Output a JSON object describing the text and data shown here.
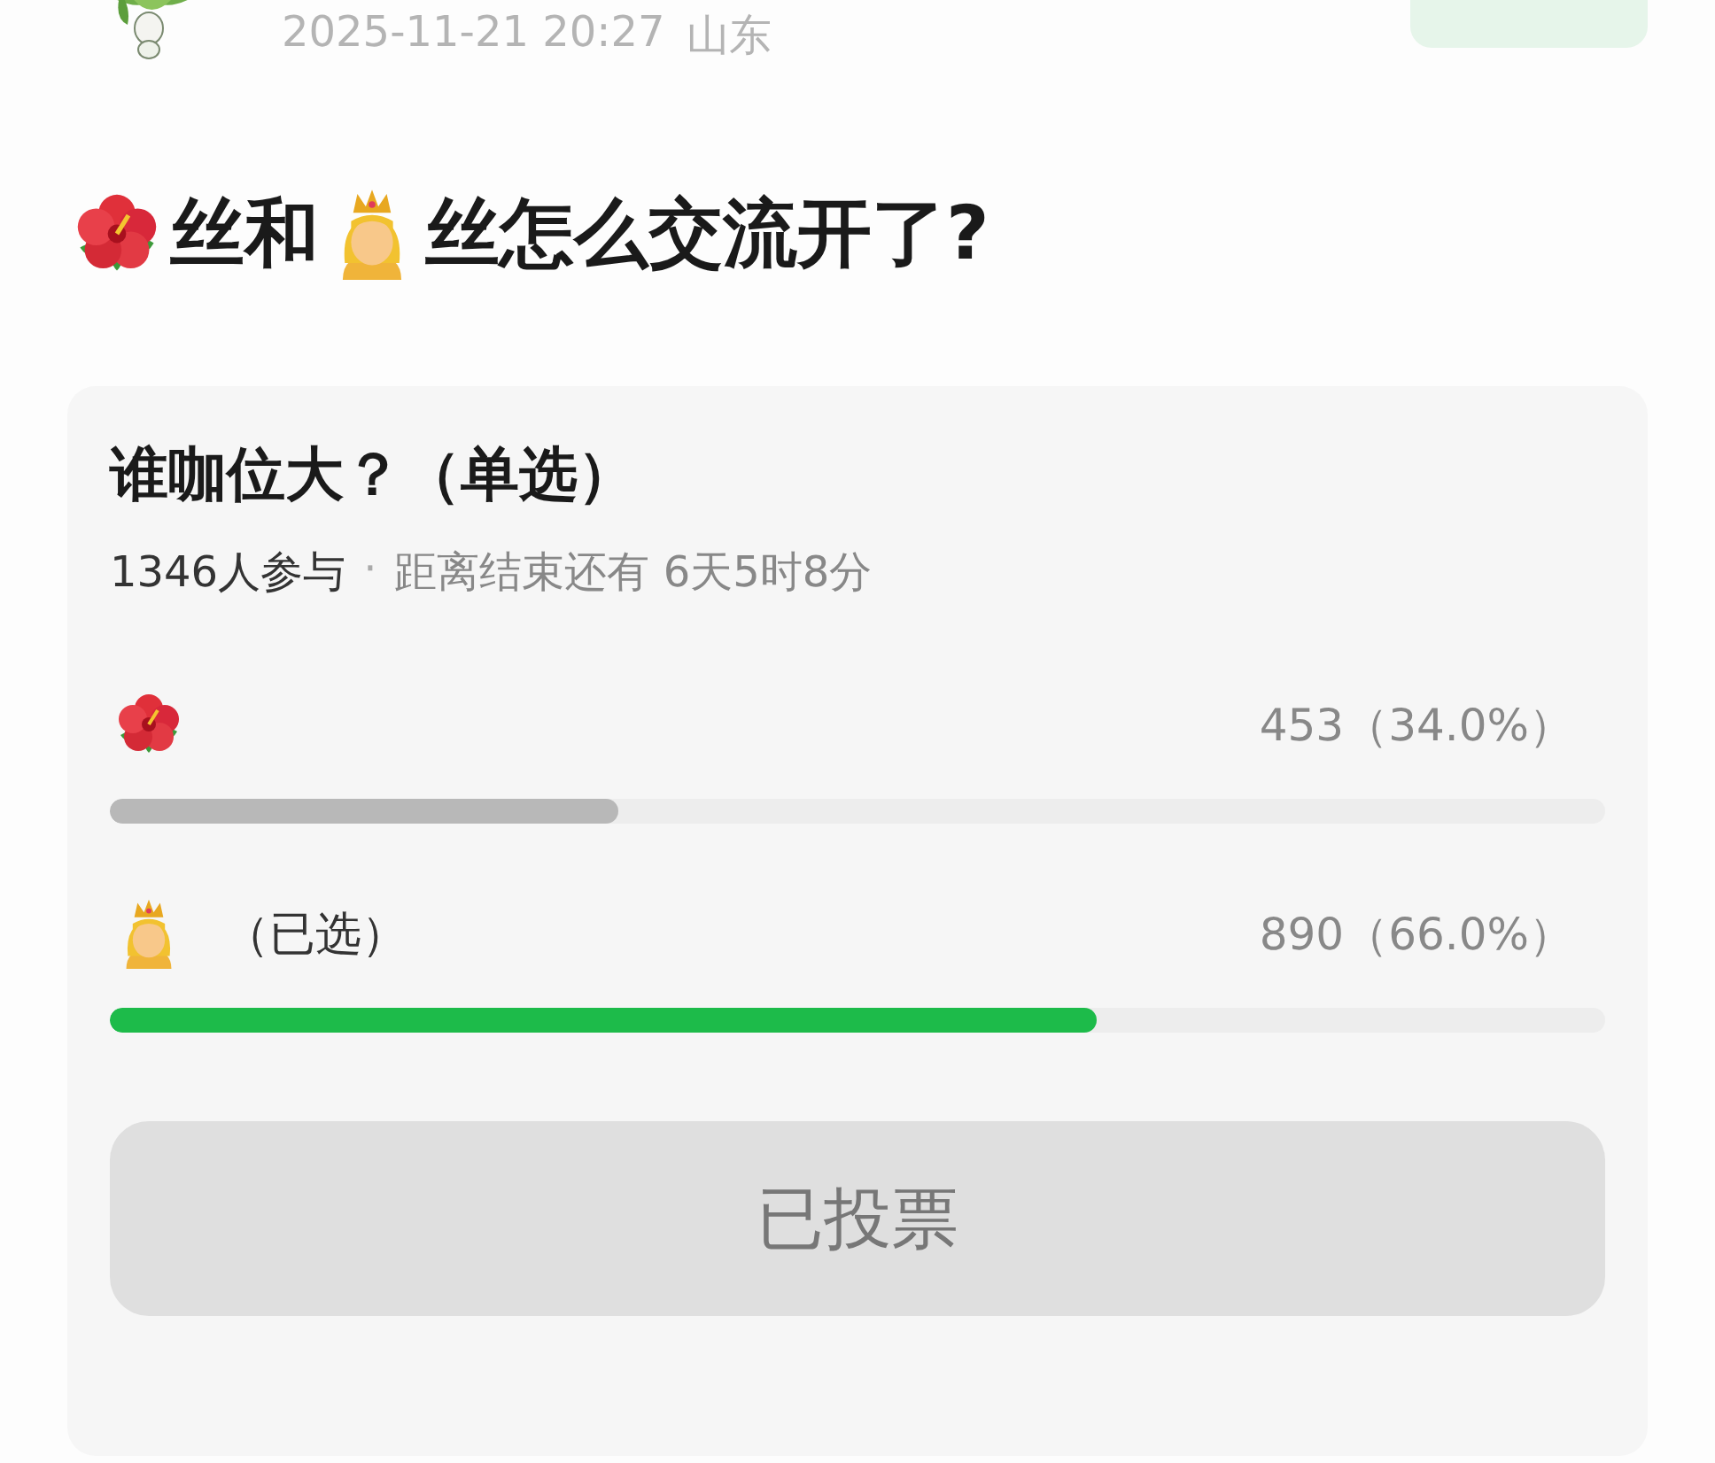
{
  "post": {
    "timestamp": "2025-11-21 20:27",
    "location": "山东",
    "title": [
      {
        "kind": "hibiscus"
      },
      {
        "kind": "text",
        "text": "丝和"
      },
      {
        "kind": "crowned-figure"
      },
      {
        "kind": "text",
        "text": "丝怎么交流开了?"
      }
    ]
  },
  "poll": {
    "question": "谁咖位大？（单选）",
    "participants": "1346人参与",
    "separator": "·",
    "remaining": "距离结束还有 6天5时8分",
    "options": [
      {
        "kind": "hibiscus",
        "count": "453（34.0%）",
        "level": 0.34,
        "selected": false
      },
      {
        "kind": "crowned-figure",
        "label": "（已选）",
        "count": "890（66.0%）",
        "level": 0.66,
        "selected": true
      }
    ],
    "button": "已投票"
  }
}
